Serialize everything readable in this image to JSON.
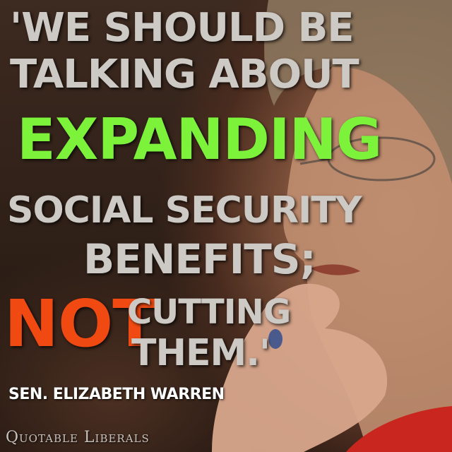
{
  "quote": {
    "line1": "'WE SHOULD BE",
    "line2": "TALKING ABOUT",
    "line3": "EXPANDING",
    "line4": "SOCIAL SECURITY",
    "line5": "BENEFITS;",
    "not_word": "NOT",
    "line6": "CUTTING",
    "line7": "THEM.'"
  },
  "attribution": "SEN. ELIZABETH WARREN",
  "watermark": "Quotable Liberals",
  "colors": {
    "main_text": "#cdc9c4",
    "highlight_green": "#7df23a",
    "highlight_orange": "#f04a12",
    "attribution": "#ffffff"
  }
}
